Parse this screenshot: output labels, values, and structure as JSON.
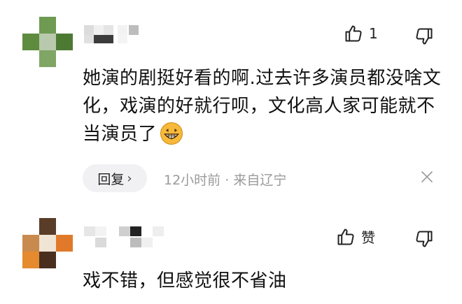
{
  "comments": [
    {
      "likes": "1",
      "text": "她演的剧挺好看的啊.过去许多演员都没啥文化，戏演的好就行呗，文化高人家可能就不当演员了",
      "emoji": "grinning-face",
      "reply_label": "回复",
      "reply_chevron": "›",
      "time": "12小时前",
      "separator": " · ",
      "location": "来自辽宁"
    },
    {
      "like_label": "赞",
      "text": "戏不错，但感觉很不省油"
    }
  ],
  "icons": {
    "like": "thumbs-up-icon",
    "dislike": "thumbs-down-icon",
    "close": "close-icon",
    "emoji": "grin-emoji-icon"
  },
  "colors": {
    "text": "#111111",
    "meta": "#9a9a9a",
    "reply_bg": "#f1f1f3",
    "emoji": "#f6b93b"
  }
}
